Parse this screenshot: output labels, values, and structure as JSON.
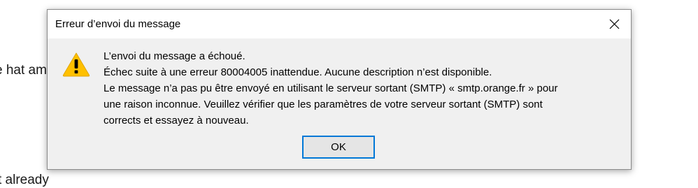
{
  "background": {
    "line1": "e hat am",
    "line2": "t already"
  },
  "dialog": {
    "title": "Erreur d’envoi du message",
    "close_icon": "close-icon",
    "warning_icon": "warning-icon",
    "message_lines": [
      "L’envoi du message a échoué.",
      "Échec suite à une erreur 80004005 inattendue. Aucune description n’est disponible.",
      "Le message n’a pas pu être envoyé en utilisant le serveur sortant (SMTP) « smtp.orange.fr » pour",
      "une raison inconnue. Veuillez vérifier que les paramètres de votre serveur sortant (SMTP) sont",
      "corrects et essayez à nouveau."
    ],
    "ok_label": "OK"
  },
  "colors": {
    "dialog_body": "#f0f0f0",
    "titlebar": "#ffffff",
    "button_focus_border": "#0078d7",
    "warning_yellow": "#ffc000"
  }
}
